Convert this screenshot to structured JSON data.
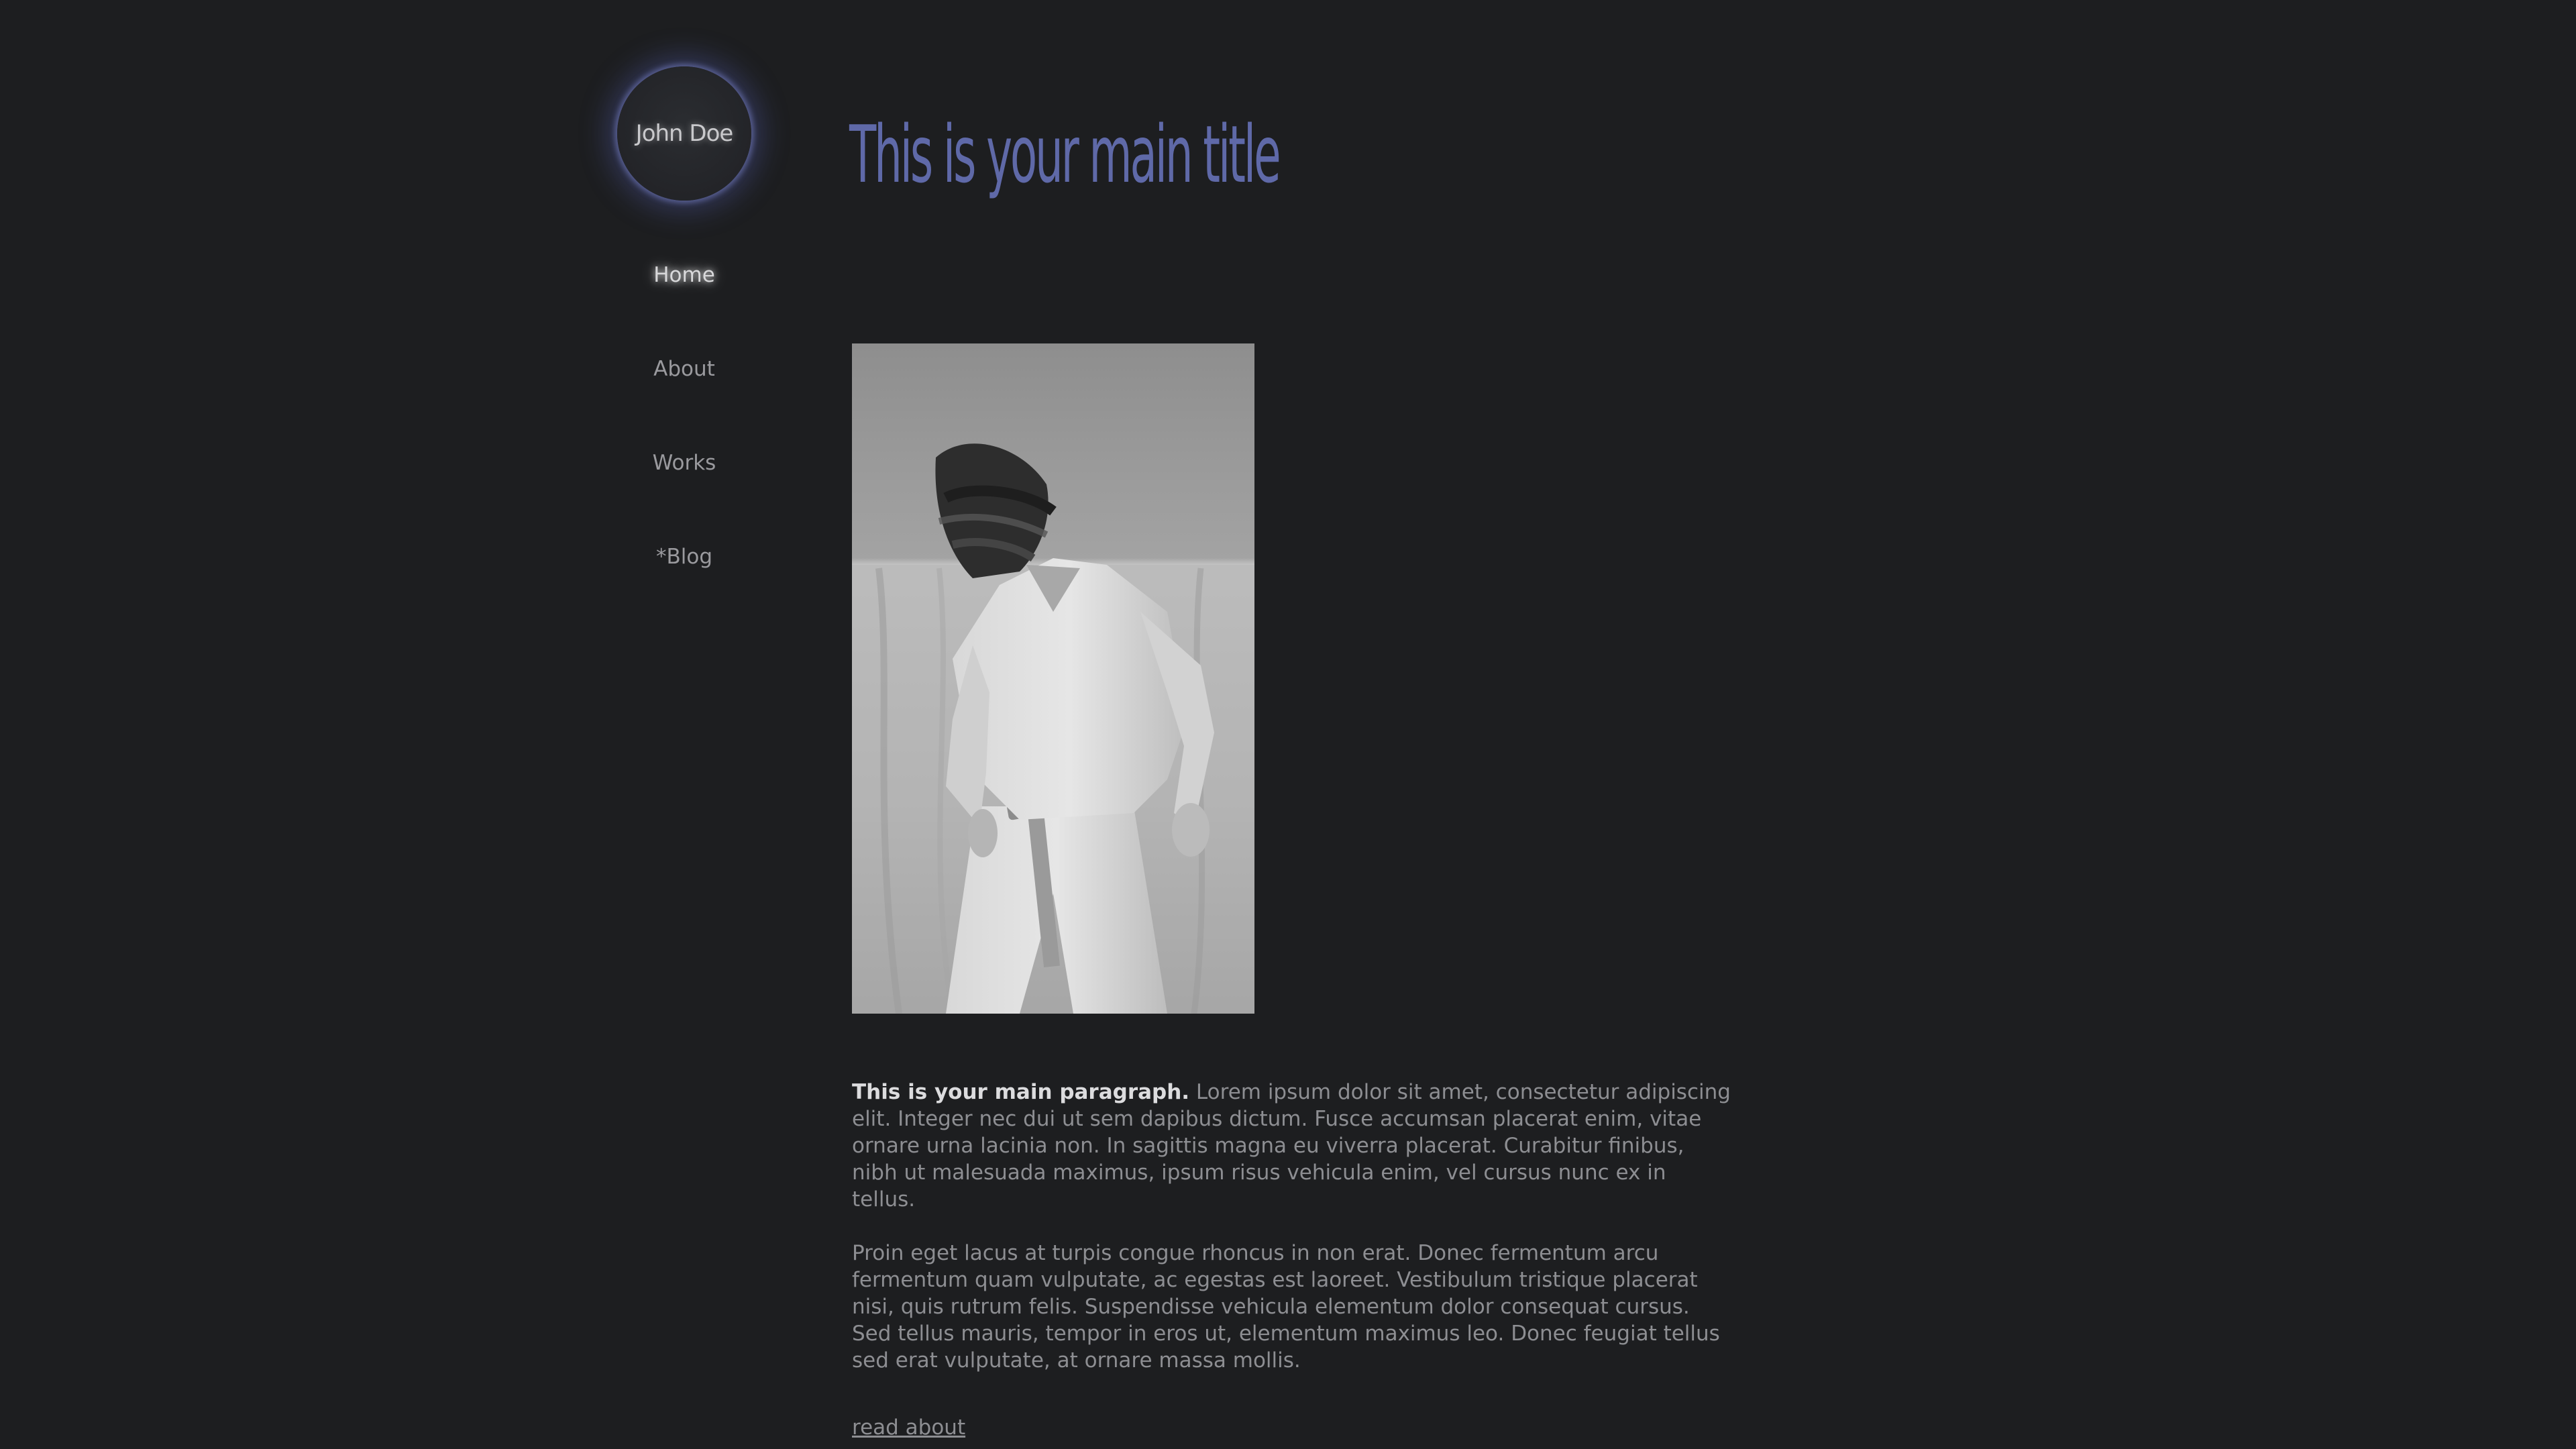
{
  "profile": {
    "name": "John Doe"
  },
  "nav": {
    "items": [
      {
        "label": "Home",
        "active": true
      },
      {
        "label": "About",
        "active": false
      },
      {
        "label": "Works",
        "active": false
      },
      {
        "label": "*Blog",
        "active": false
      }
    ]
  },
  "main": {
    "title": "This is your main title",
    "photo": {
      "subject": "black-and-white portrait of a man in a linen shirt and trousers",
      "style": "grayscale"
    },
    "paragraph1": {
      "lead": "This is your main paragraph.",
      "text": " Lorem ipsum dolor sit amet, consectetur adipiscing elit. Integer nec dui ut sem dapibus dictum. Fusce accumsan placerat enim, vitae ornare urna lacinia non. In sagittis magna eu viverra placerat. Curabitur finibus, nibh ut malesuada maximus, ipsum risus vehicula enim, vel cursus nunc ex in tellus."
    },
    "paragraph2": {
      "text": "Proin eget lacus at turpis congue rhoncus in non erat. Donec fermentum arcu fermentum quam vulputate, ac egestas est laoreet. Vestibulum tristique placerat nisi, quis rutrum felis. Suspendisse vehicula elementum dolor consequat cursus. Sed tellus mauris, tempor in eros ut, elementum maximus leo. Donec feugiat tellus sed erat vulputate, at ornare massa mollis."
    },
    "link": "read about"
  },
  "colors": {
    "background": "#1d1e20",
    "title": "#5f69a8",
    "text": "#8d8e92",
    "glow": "#6e78c8"
  }
}
